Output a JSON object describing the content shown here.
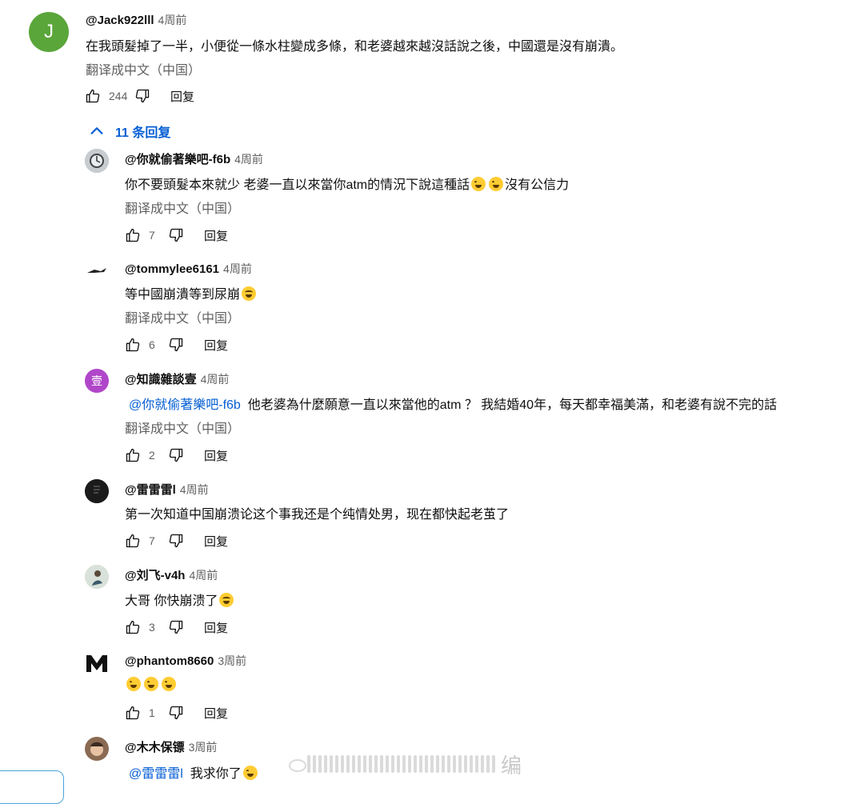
{
  "top_comment": {
    "avatar_letter": "J",
    "avatar_color": "#5aa63a",
    "author": "@Jack922lll",
    "time": "4周前",
    "text": "在我頭髮掉了一半，小便從一條水柱變成多條，和老婆越來越沒話說之後，中國還是沒有崩潰。",
    "translate": "翻译成中文（中国）",
    "likes": "244",
    "reply_label": "回复"
  },
  "replies_toggle": {
    "label": "11 条回复"
  },
  "replies": [
    {
      "author": "@你就偷著樂吧-f6b",
      "time": "4周前",
      "text": "你不要頭髮本來就少 老婆一直以來當你atm的情況下說這種話",
      "text_suffix": "沒有公信力",
      "translate": "翻译成中文（中国）",
      "likes": "7",
      "reply_label": "回复"
    },
    {
      "author": "@tommylee6161",
      "time": "4周前",
      "text": "等中國崩潰等到尿崩",
      "translate": "翻译成中文（中国）",
      "likes": "6",
      "reply_label": "回复"
    },
    {
      "author": "@知識雜談壹",
      "avatar_letter": "壹",
      "avatar_color": "#b046c9",
      "time": "4周前",
      "mention": "@你就偷著樂吧-f6b",
      "text": "他老婆為什麼願意一直以來當他的atm  ？ 我結婚40年，每天都幸福美滿，和老婆有說不完的話",
      "translate": "翻译成中文（中国）",
      "likes": "2",
      "reply_label": "回复"
    },
    {
      "author": "@雷雷雷l",
      "time": "4周前",
      "text": "第一次知道中国崩溃论这个事我还是个纯情处男，现在都快起老茧了",
      "likes": "7",
      "reply_label": "回复"
    },
    {
      "author": "@刘飞-v4h",
      "time": "4周前",
      "text": "大哥 你快崩溃了",
      "likes": "3",
      "reply_label": "回复"
    },
    {
      "author": "@phantom8660",
      "time": "3周前",
      "likes": "1",
      "reply_label": "回复"
    },
    {
      "author": "@木木保镖",
      "time": "3周前",
      "mention": "@雷雷雷l",
      "text": "我求你了"
    }
  ],
  "watermark": {
    "text": "编"
  },
  "colors": {
    "link": "#065fd4",
    "secondary": "#606060",
    "primary": "#0f0f0f"
  }
}
